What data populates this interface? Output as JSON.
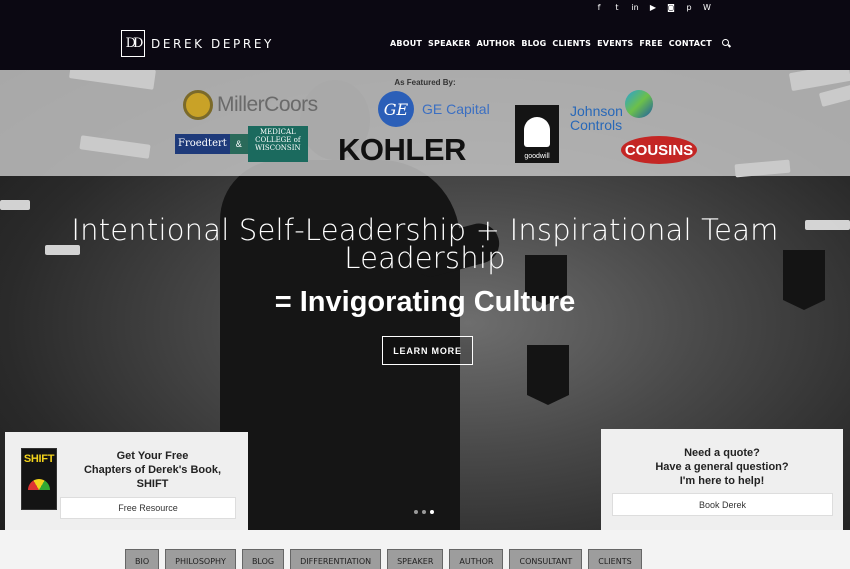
{
  "header": {
    "logo_mark": "DD",
    "logo_text": "DEREK DEPREY",
    "social_icons": [
      "facebook-icon",
      "twitter-icon",
      "linkedin-icon",
      "youtube-icon",
      "instagram-icon",
      "pinterest-icon",
      "wordpress-icon"
    ],
    "social_glyphs": [
      "f",
      "t",
      "in",
      "▶",
      "◙",
      "p",
      "W"
    ],
    "nav": [
      "ABOUT",
      "SPEAKER",
      "AUTHOR",
      "BLOG",
      "CLIENTS",
      "EVENTS",
      "FREE",
      "CONTACT"
    ]
  },
  "featured": {
    "title": "As Featured By:",
    "brands": {
      "millercoors": "MillerCoors",
      "ge_mark": "GE",
      "ge": "GE Capital",
      "goodwill": "goodwill",
      "johnson_controls_1": "Johnson",
      "johnson_controls_2": "Controls",
      "froedtert": "Froedtert",
      "froedtert_amp": "&",
      "mcw": "MEDICAL COLLEGE of WISCONSIN",
      "kohler": "KOHLER",
      "cousins": "COUSINS"
    }
  },
  "hero": {
    "headline_line1": "Intentional Self-Leadership + Inspirational Team",
    "headline_line2": "Leadership",
    "subhead": "= Invigorating Culture",
    "button": "LEARN MORE"
  },
  "card_left": {
    "book_title": "SHIFT",
    "title_line1": "Get Your Free",
    "title_line2": "Chapters of Derek's Book,",
    "title_line3": "SHIFT",
    "button": "Free Resource"
  },
  "card_right": {
    "title_line1": "Need a quote?",
    "title_line2": "Have a general question?",
    "title_line3": "I'm here to help!",
    "button": "Book Derek"
  },
  "tabs": [
    "BIO",
    "PHILOSOPHY",
    "BLOG",
    "DIFFERENTIATION",
    "SPEAKER",
    "AUTHOR",
    "CONSULTANT",
    "CLIENTS"
  ],
  "carousel": {
    "slide_count": 3,
    "active_index": 2
  }
}
